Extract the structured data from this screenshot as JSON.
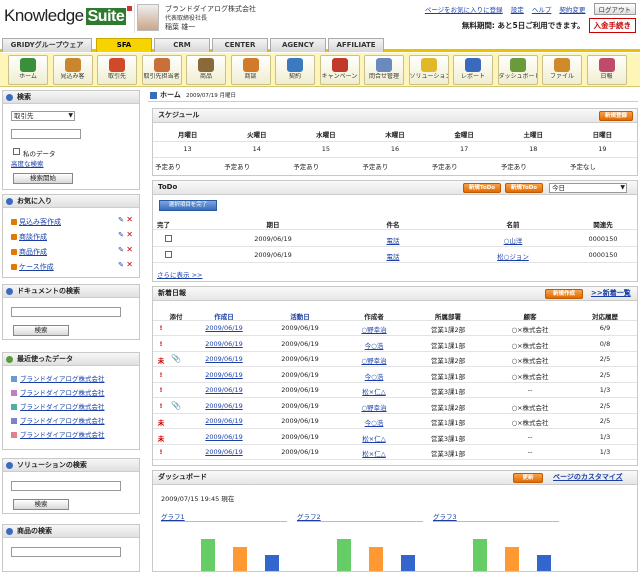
{
  "header": {
    "logo_main": "Knowledge",
    "logo_suite": "Suite",
    "company": "ブランドダイアログ株式会社",
    "role": "代表取締役社長",
    "user_name": "稲葉 雄一",
    "link_favorite": "ページをお気に入りに登録",
    "link_settings": "設定",
    "link_help": "ヘルプ",
    "link_contract": "契約変更",
    "logout": "ログアウト",
    "trial_text": "無料期間: あと5日ご利用できます。",
    "pay_button": "入金手続き"
  },
  "tabs": [
    "GRIDYグループウェア",
    "SFA",
    "CRM",
    "CENTER",
    "AGENCY",
    "AFFILIATE"
  ],
  "active_tab": "SFA",
  "toolbar": [
    {
      "label": "ホーム",
      "icon": "home-icon",
      "color": "#3a8f3a"
    },
    {
      "label": "見込み客",
      "icon": "prospect-icon",
      "color": "#c9862a"
    },
    {
      "label": "取引先",
      "icon": "client-icon",
      "color": "#d04a2a"
    },
    {
      "label": "取引先担当者",
      "icon": "contact-icon",
      "color": "#c9703a"
    },
    {
      "label": "商品",
      "icon": "product-icon",
      "color": "#8a6a3a"
    },
    {
      "label": "商談",
      "icon": "deal-icon",
      "color": "#d07a2a"
    },
    {
      "label": "契約",
      "icon": "contract-icon",
      "color": "#3a7abd"
    },
    {
      "label": "キャンペーン",
      "icon": "campaign-icon",
      "color": "#c0392b"
    },
    {
      "label": "問合せ管理",
      "icon": "inquiry-icon",
      "color": "#6a8abd"
    },
    {
      "label": "ソリューション",
      "icon": "solution-icon",
      "color": "#e0b82a"
    },
    {
      "label": "レポート",
      "icon": "report-icon",
      "color": "#3a6abd"
    },
    {
      "label": "ダッシュボード",
      "icon": "dashboard-icon",
      "color": "#6a9a3a"
    },
    {
      "label": "ファイル",
      "icon": "file-icon",
      "color": "#d08a2a"
    },
    {
      "label": "日報",
      "icon": "daily-report-icon",
      "color": "#c04a6a"
    }
  ],
  "sidebar": {
    "search": {
      "title": "検索",
      "select_value": "取引先",
      "my_data": "私のデータ",
      "advanced": "高度な検索",
      "button": "検索開始"
    },
    "favorites": {
      "title": "お気に入り",
      "items": [
        "見込み客作成",
        "商談作成",
        "商品作成",
        "ケース作成"
      ]
    },
    "doc_search": {
      "title": "ドキュメントの検索",
      "button": "検索"
    },
    "recent": {
      "title": "最近使ったデータ",
      "items": [
        {
          "label": "ブランドダイアログ株式会社",
          "color": "#6a9ad0"
        },
        {
          "label": "ブランドダイアログ株式会社",
          "color": "#c080c0"
        },
        {
          "label": "ブランドダイアログ株式会社",
          "color": "#50b0a0"
        },
        {
          "label": "ブランドダイアログ株式会社",
          "color": "#8080d0"
        },
        {
          "label": "ブランドダイアログ株式会社",
          "color": "#e08090"
        }
      ]
    },
    "solution_search": {
      "title": "ソリューションの検索",
      "button": "検索"
    },
    "product_search": {
      "title": "商品の検索"
    }
  },
  "breadcrumb": {
    "title": "ホーム",
    "date": "2009/07/19 月曜日"
  },
  "schedule": {
    "title": "スケジュール",
    "new_button": "新規登録",
    "days": [
      "月曜日",
      "火曜日",
      "水曜日",
      "木曜日",
      "金曜日",
      "土曜日",
      "日曜日"
    ],
    "dates": [
      "13",
      "14",
      "15",
      "16",
      "17",
      "18",
      "19"
    ],
    "status": [
      "予定あり",
      "予定あり",
      "予定あり",
      "予定あり",
      "予定あり",
      "予定あり",
      "予定なし"
    ]
  },
  "todo": {
    "title": "ToDo",
    "btn_new1": "新規ToDo",
    "btn_new2": "新規ToDo",
    "filter": "今日",
    "complete_btn": "選択項目を完了",
    "headers": [
      "完了",
      "期日",
      "件名",
      "名前",
      "関連先"
    ],
    "rows": [
      {
        "date": "2009/06/19",
        "subject": "電話",
        "name": "○山洋",
        "related": "0000150"
      },
      {
        "date": "2009/06/19",
        "subject": "電話",
        "name": "松○ジョン",
        "related": "0000150"
      }
    ],
    "more": "さらに表示 >>"
  },
  "daily": {
    "title": "新着日報",
    "new_button": "新規作成",
    "list_link": ">>新着一覧",
    "headers": [
      "添付",
      "作成日",
      "活動日",
      "作成者",
      "所属部署",
      "顧客",
      "対応履歴"
    ],
    "rows": [
      {
        "flag": "!",
        "clip": false,
        "created": "2009/06/19",
        "activity": "2009/06/19",
        "author": "○野幸治",
        "dept": "営業1課2部",
        "customer": "○×株式会社",
        "hist": "6/9"
      },
      {
        "flag": "!",
        "clip": false,
        "created": "2009/06/19",
        "activity": "2009/06/19",
        "author": "今○浩",
        "dept": "営業1課1部",
        "customer": "○×株式会社",
        "hist": "0/8"
      },
      {
        "flag": "未",
        "clip": true,
        "created": "2009/06/19",
        "activity": "2009/06/19",
        "author": "○野幸治",
        "dept": "営業1課2部",
        "customer": "○×株式会社",
        "hist": "2/5"
      },
      {
        "flag": "!",
        "clip": false,
        "created": "2009/06/19",
        "activity": "2009/06/19",
        "author": "今○浩",
        "dept": "営業1課1部",
        "customer": "○×株式会社",
        "hist": "2/5"
      },
      {
        "flag": "!",
        "clip": false,
        "created": "2009/06/19",
        "activity": "2009/06/19",
        "author": "松×仁△",
        "dept": "営業3課1部",
        "customer": "--",
        "hist": "1/3"
      },
      {
        "flag": "!",
        "clip": true,
        "created": "2009/06/19",
        "activity": "2009/06/19",
        "author": "○野幸治",
        "dept": "営業1課2部",
        "customer": "○×株式会社",
        "hist": "2/5"
      },
      {
        "flag": "未",
        "clip": false,
        "created": "2009/06/19",
        "activity": "2009/06/19",
        "author": "今○浩",
        "dept": "営業1課1部",
        "customer": "○×株式会社",
        "hist": "2/5"
      },
      {
        "flag": "未",
        "clip": false,
        "created": "2009/06/19",
        "activity": "2009/06/19",
        "author": "松×仁△",
        "dept": "営業3課1部",
        "customer": "--",
        "hist": "1/3"
      },
      {
        "flag": "!",
        "clip": false,
        "created": "2009/06/19",
        "activity": "2009/06/19",
        "author": "松×仁△",
        "dept": "営業3課1部",
        "customer": "--",
        "hist": "1/3"
      }
    ]
  },
  "dashboard": {
    "title": "ダッシュボード",
    "refresh": "更新",
    "customize": "ページのカスタマイズ",
    "timestamp": "2009/07/15 19:45 現在",
    "graphs": [
      "グラフ1",
      "グラフ2",
      "グラフ3"
    ]
  }
}
